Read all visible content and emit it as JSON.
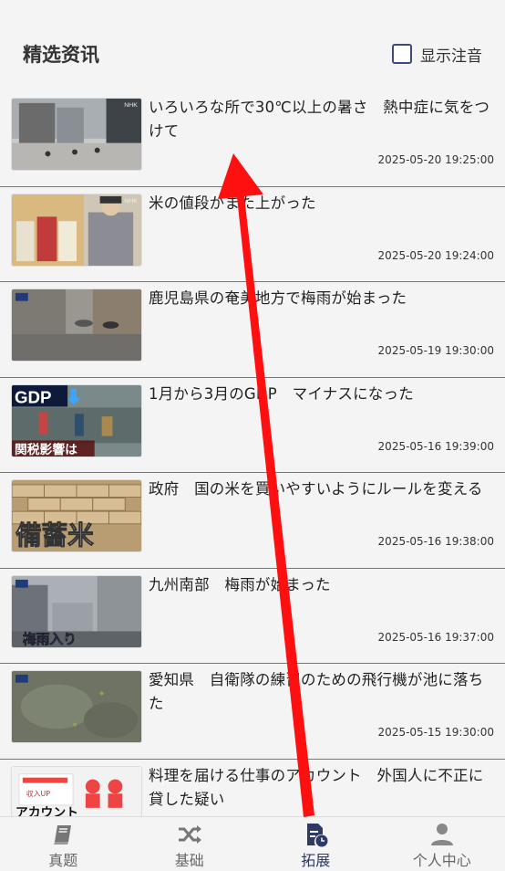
{
  "header": {
    "title": "精选资讯",
    "toggle_label": "显示注音"
  },
  "news": [
    {
      "title": "いろいろな所で30℃以上の暑さ　熱中症に気をつけて",
      "date": "2025-05-20 19:25:00",
      "thumb_text": "",
      "badge": "NHK"
    },
    {
      "title": "米の値段がまた上がった",
      "date": "2025-05-20 19:24:00",
      "thumb_text": "",
      "badge": "NHK"
    },
    {
      "title": "鹿児島県の奄美地方で梅雨が始まった",
      "date": "2025-05-19 19:30:00",
      "thumb_text": "",
      "badge": "NHK"
    },
    {
      "title": "1月から3月のGDP　マイナスになった",
      "date": "2025-05-16 19:39:00",
      "thumb_text": "関税影響は",
      "badge": "GDP"
    },
    {
      "title": "政府　国の米を買いやすいようにルールを変える",
      "date": "2025-05-16 19:38:00",
      "thumb_text": "備蓄米",
      "badge": "NHK"
    },
    {
      "title": "九州南部　梅雨が始まった",
      "date": "2025-05-16 19:37:00",
      "thumb_text": "梅雨入り",
      "badge": "NHK"
    },
    {
      "title": "愛知県　自衛隊の練習のための飛行機が池に落ちた",
      "date": "2025-05-15 19:30:00",
      "thumb_text": "",
      "badge": "NHK"
    },
    {
      "title": "料理を届ける仕事のアカウント　外国人に不正に貸した疑い",
      "date": "",
      "thumb_text": "アカウント",
      "badge": "収入UP"
    }
  ],
  "tabs": [
    {
      "label": "真题",
      "icon": "book-icon",
      "active": false
    },
    {
      "label": "基础",
      "icon": "shuffle-icon",
      "active": false
    },
    {
      "label": "拓展",
      "icon": "document-clock-icon",
      "active": true
    },
    {
      "label": "个人中心",
      "icon": "person-icon",
      "active": false
    }
  ],
  "colors": {
    "accent": "#2e3966",
    "inactive": "#777777",
    "arrow": "#ff1010"
  }
}
